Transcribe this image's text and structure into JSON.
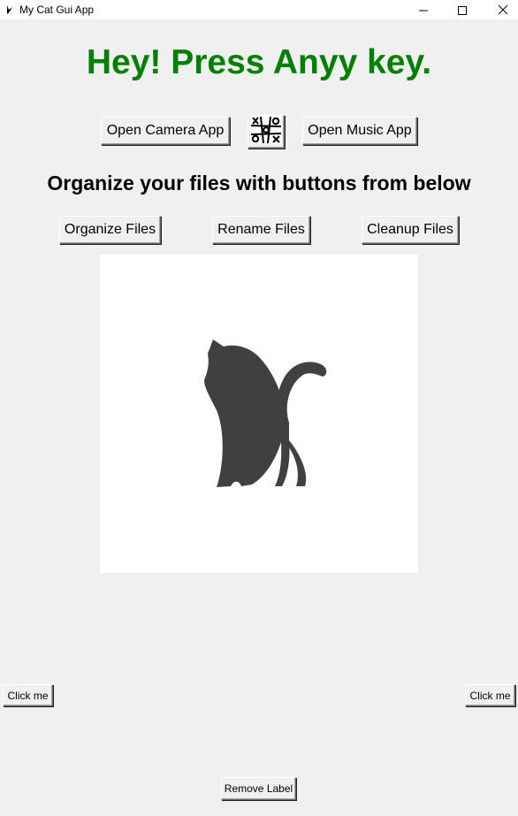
{
  "window": {
    "title": "My Cat Gui App",
    "app_icon": "feather-icon",
    "controls": [
      "minimize-icon",
      "maximize-icon",
      "close-icon"
    ]
  },
  "heading": {
    "text": "Hey! Press Anyy key.",
    "color": "#008000"
  },
  "top_buttons": {
    "camera": "Open Camera App",
    "tictactoe_icon": "tic-tac-toe-icon",
    "music": "Open Music App"
  },
  "subheading": "Organize your files with buttons from below",
  "file_buttons": {
    "organize": "Organize Files",
    "rename": "Rename Files",
    "cleanup": "Cleanup Files"
  },
  "image": {
    "icon": "cat-icon",
    "color": "#404040"
  },
  "side_buttons": {
    "left": "Click me",
    "right": "Click me"
  },
  "bottom_button": "Remove Label"
}
